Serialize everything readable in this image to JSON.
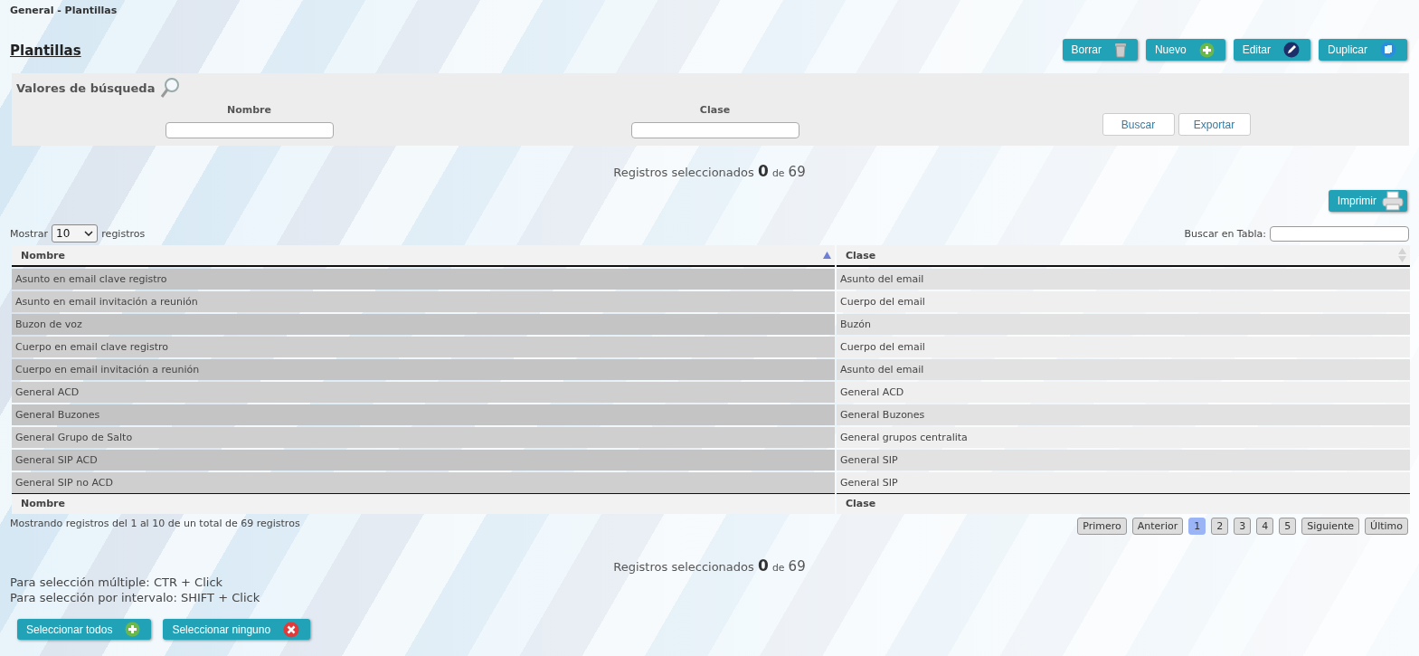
{
  "breadcrumb": "General - Plantillas",
  "title": "Plantillas",
  "actions": [
    {
      "label": "Borrar",
      "kind": "trash"
    },
    {
      "label": "Nuevo",
      "kind": "plus"
    },
    {
      "label": "Editar",
      "kind": "pencil"
    },
    {
      "label": "Duplicar",
      "kind": "copy"
    }
  ],
  "search": {
    "title": "Valores de búsqueda",
    "fields": [
      {
        "label": "Nombre"
      },
      {
        "label": "Clase"
      }
    ],
    "buttons": [
      "Buscar",
      "Exportar"
    ]
  },
  "selected_count": {
    "prefix": "Registros seleccionados",
    "count": "0",
    "of": "de",
    "total": "69"
  },
  "print_button": {
    "label": "Imprimir",
    "kind": "printer"
  },
  "length": {
    "before": "Mostrar",
    "value": "10",
    "after": "registros"
  },
  "table_search": {
    "label": "Buscar en Tabla:"
  },
  "table": {
    "columns": [
      {
        "label": "Nombre",
        "sorted": true
      },
      {
        "label": "Clase",
        "sorted": false
      }
    ],
    "rows": [
      [
        "Asunto en email clave registro",
        "Asunto del email"
      ],
      [
        "Asunto en email invitación a reunión",
        "Cuerpo del email"
      ],
      [
        "Buzon de voz",
        "Buzón"
      ],
      [
        "Cuerpo en email clave registro",
        "Cuerpo del email"
      ],
      [
        "Cuerpo en email invitación a reunión",
        "Asunto del email"
      ],
      [
        "General ACD",
        "General ACD"
      ],
      [
        "General Buzones",
        "General Buzones"
      ],
      [
        "General Grupo de Salto",
        "General grupos centralita"
      ],
      [
        "General SIP ACD",
        "General SIP"
      ],
      [
        "General SIP no ACD",
        "General SIP"
      ]
    ],
    "footer": [
      "Nombre",
      "Clase"
    ]
  },
  "info": "Mostrando registros del 1 al 10 de un total de 69 registros",
  "pagination": [
    {
      "label": "Primero",
      "selected": false
    },
    {
      "label": "Anterior",
      "selected": false
    },
    {
      "label": "1",
      "selected": true
    },
    {
      "label": "2",
      "selected": false
    },
    {
      "label": "3",
      "selected": false
    },
    {
      "label": "4",
      "selected": false
    },
    {
      "label": "5",
      "selected": false
    },
    {
      "label": "Siguiente",
      "selected": false
    },
    {
      "label": "Último",
      "selected": false
    }
  ],
  "selected_count_bottom": {
    "prefix": "Registros seleccionados",
    "count": "0",
    "of": "de",
    "total": "69"
  },
  "notes": [
    "Para selección múltiple: CTR + Click",
    "Para selección por intervalo: SHIFT + Click"
  ],
  "selection_buttons": [
    {
      "label": "Seleccionar todos",
      "kind": "plus"
    },
    {
      "label": "Seleccionar ninguno",
      "kind": "cross"
    }
  ]
}
